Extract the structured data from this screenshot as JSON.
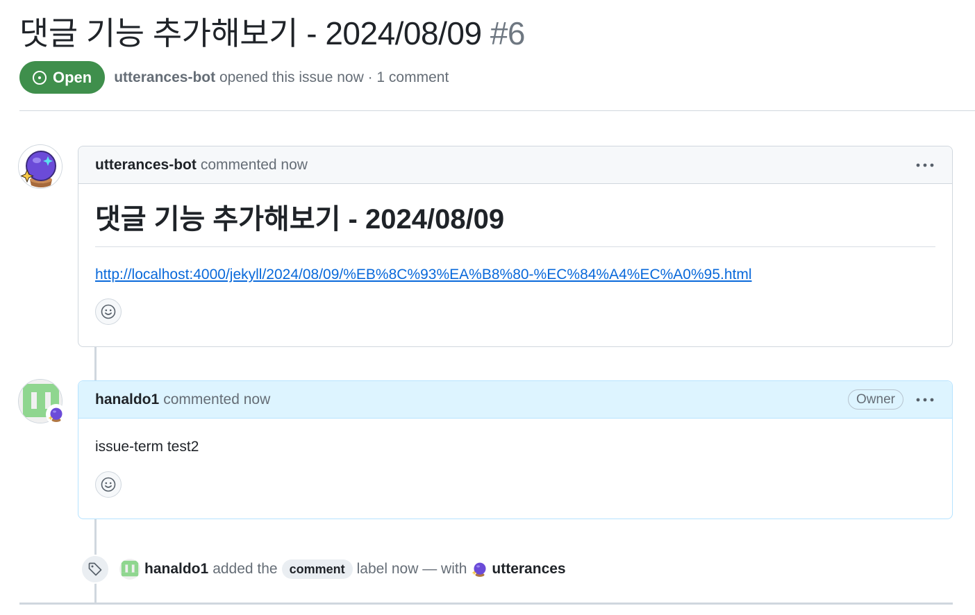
{
  "issue": {
    "title": "댓글 기능 추가해보기 - 2024/08/09",
    "number": "#6",
    "state": "Open",
    "author": "utterances-bot",
    "meta_suffix": "opened this issue now · 1 comment"
  },
  "comments": [
    {
      "author": "utterances-bot",
      "action": "commented now",
      "heading": "댓글 기능 추가해보기 - 2024/08/09",
      "link": "http://localhost:4000/jekyll/2024/08/09/%EB%8C%93%EA%B8%80-%EC%84%A4%EC%A0%95.html",
      "avatar": "crystal-ball-icon"
    },
    {
      "author": "hanaldo1",
      "action": "commented now",
      "badge": "Owner",
      "text": "issue-term test2",
      "avatar": "identicon-green"
    }
  ],
  "label_event": {
    "actor": "hanaldo1",
    "added": "added the",
    "label": "comment",
    "suffix": "label now — with",
    "app": "utterances",
    "icon": "tag-icon"
  },
  "colors": {
    "open_green": "#3f8f4c",
    "link_blue": "#0969da",
    "owner_header": "#ddf4ff",
    "identicon": "#8fd68f"
  }
}
